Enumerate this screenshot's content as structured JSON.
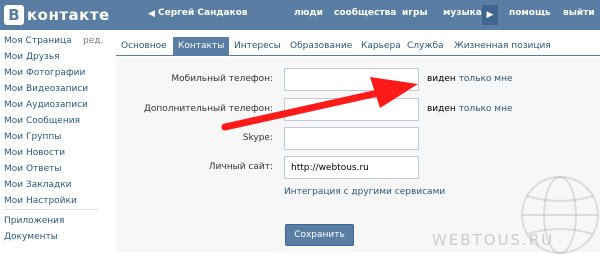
{
  "header": {
    "logo_letter": "В",
    "logo_text": "контакте",
    "back_icon": "back-arrow-icon",
    "user_name": "Сергей Сандаков",
    "nav": [
      "люди",
      "сообщества",
      "игры",
      "музыка",
      "помощь",
      "выйти"
    ],
    "play_icon": "play-icon",
    "brand_color": "#597da3"
  },
  "sidebar": {
    "items": [
      "Моя Страница",
      "Мои Друзья",
      "Мои Фотографии",
      "Мои Видеозаписи",
      "Мои Аудиозаписи",
      "Мои Сообщения",
      "Мои Группы",
      "Мои Новости",
      "Мои Ответы",
      "Мои Закладки",
      "Мои Настройки"
    ],
    "edit_label": "ред.",
    "extra": [
      "Приложения",
      "Документы"
    ]
  },
  "tabs": [
    "Основное",
    "Контакты",
    "Интересы",
    "Образование",
    "Карьера",
    "Служба",
    "Жизненная позиция"
  ],
  "active_tab": "Контакты",
  "form": {
    "fields": [
      {
        "label": "Мобильный телефон:",
        "value": "",
        "visibility_word": "виден",
        "visibility_link": "только мне"
      },
      {
        "label": "Дополнительный телефон:",
        "value": "",
        "visibility_word": "виден",
        "visibility_link": "только мне"
      },
      {
        "label": "Skype:",
        "value": ""
      },
      {
        "label": "Личный сайт:",
        "value": "http://webtous.ru"
      }
    ],
    "integration_link": "Интеграция с другими сервисами",
    "save_label": "Сохранить"
  },
  "annotation": {
    "color": "#ff1a1a"
  },
  "watermark": "WEBTOUS.RU"
}
